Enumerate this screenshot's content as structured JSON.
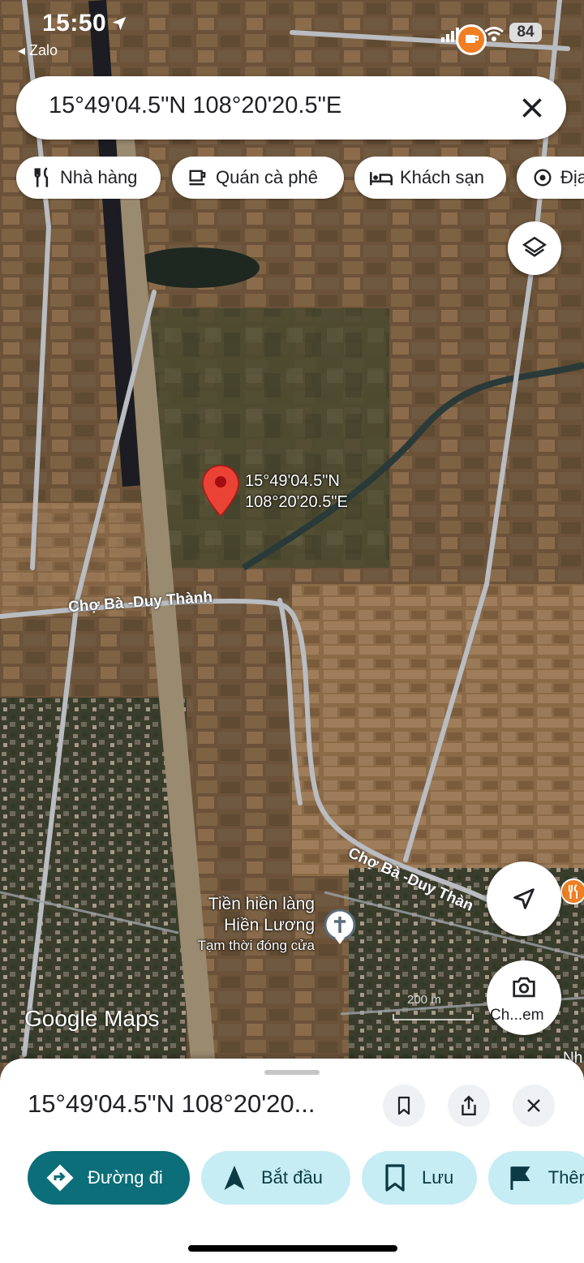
{
  "status_bar": {
    "time": "15:50",
    "back_app": "◂ Zalo",
    "battery": "84"
  },
  "search": {
    "query": "15°49'04.5\"N 108°20'20.5\"E"
  },
  "chips": [
    {
      "label": "Nhà hàng",
      "icon": "restaurant-icon"
    },
    {
      "label": "Quán cà phê",
      "icon": "coffee-icon"
    },
    {
      "label": "Khách sạn",
      "icon": "hotel-icon"
    },
    {
      "label": "Địa",
      "icon": "attraction-icon"
    }
  ],
  "map": {
    "pin_label_line1": "15°49'04.5\"N",
    "pin_label_line2": "108°20'20.5\"E",
    "road_labels": [
      "Chợ Bà -Duy Thành",
      "Chợ Bà -Duy Thàn"
    ],
    "poi": {
      "name_line1": "Tiền hiền làng",
      "name_line2": "Hiền Lương",
      "status": "Tạm thời đóng cửa"
    },
    "edge_label": "Nh",
    "scale_text": "200 m",
    "logo": "Google Maps",
    "streetview_label": "Ch...em"
  },
  "sheet": {
    "title": "15°49'04.5\"N 108°20'20...",
    "actions": [
      {
        "label": "Đường đi",
        "icon": "directions-icon"
      },
      {
        "label": "Bắt đầu",
        "icon": "navigation-icon"
      },
      {
        "label": "Lưu",
        "icon": "bookmark-icon"
      },
      {
        "label": "Thêm",
        "icon": "flag-icon"
      }
    ]
  },
  "colors": {
    "accent": "#0b6e78",
    "chip_light": "#c6ecf4",
    "pin": "#ea4335",
    "orange_badge": "#f07e22"
  }
}
